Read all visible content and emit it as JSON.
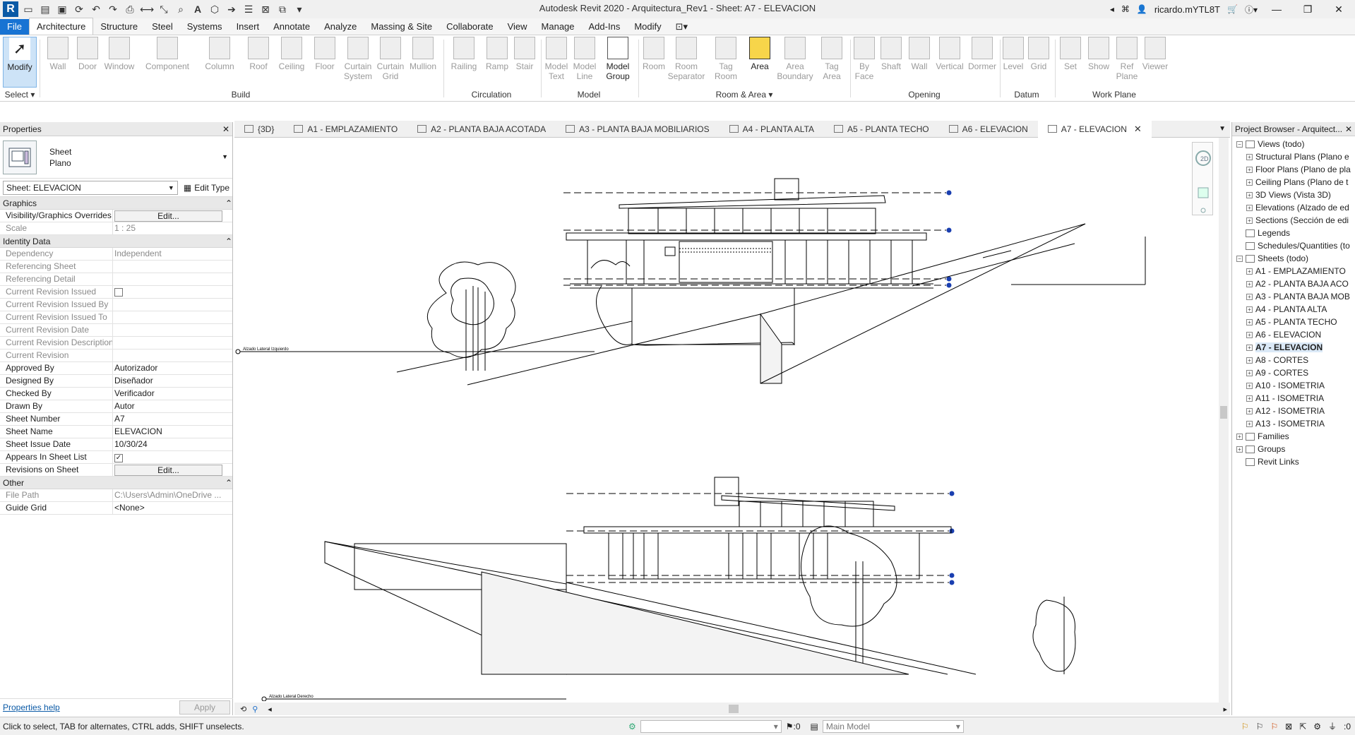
{
  "window": {
    "title": "Autodesk Revit 2020 - Arquitectura_Rev1 - Sheet: A7 - ELEVACION",
    "user": "ricardo.mYTL8T"
  },
  "ribbon_tabs": [
    "File",
    "Architecture",
    "Structure",
    "Steel",
    "Systems",
    "Insert",
    "Annotate",
    "Analyze",
    "Massing & Site",
    "Collaborate",
    "View",
    "Manage",
    "Add-Ins",
    "Modify"
  ],
  "ribbon": {
    "select": {
      "modify": "Modify",
      "select": "Select"
    },
    "build": {
      "label": "Build",
      "wall": "Wall",
      "door": "Door",
      "window": "Window",
      "component": "Component",
      "column": "Column",
      "roof": "Roof",
      "ceiling": "Ceiling",
      "floor": "Floor",
      "curtain_system": "Curtain System",
      "curtain_grid": "Curtain Grid",
      "mullion": "Mullion"
    },
    "circulation": {
      "label": "Circulation",
      "railing": "Railing",
      "ramp": "Ramp",
      "stair": "Stair"
    },
    "model": {
      "label": "Model",
      "model_text": "Model Text",
      "model_line": "Model Line",
      "model_group": "Model Group"
    },
    "room_area": {
      "label": "Room & Area",
      "room": "Room",
      "room_separator": "Room Separator",
      "tag_room": "Tag Room",
      "area": "Area",
      "area_boundary": "Area Boundary",
      "tag_area": "Tag Area"
    },
    "opening": {
      "label": "Opening",
      "by_face": "By Face",
      "shaft": "Shaft",
      "wall": "Wall",
      "vertical": "Vertical",
      "dormer": "Dormer"
    },
    "datum": {
      "label": "Datum",
      "level": "Level",
      "grid": "Grid"
    },
    "work_plane": {
      "label": "Work Plane",
      "set": "Set",
      "show": "Show",
      "ref_plane": "Ref Plane",
      "viewer": "Viewer"
    }
  },
  "properties": {
    "header": "Properties",
    "type_name_line1": "Sheet",
    "type_name_line2": "Plano",
    "instance_selector": "Sheet: ELEVACION",
    "edit_type": "Edit Type",
    "groups": {
      "graphics": "Graphics",
      "identity": "Identity Data",
      "other": "Other"
    },
    "graphics": [
      {
        "k": "Visibility/Graphics Overrides",
        "v": "Edit...",
        "kind": "button"
      },
      {
        "k": "Scale",
        "v": "1 : 25",
        "kind": "disabled"
      }
    ],
    "identity": [
      {
        "k": "Dependency",
        "v": "Independent",
        "kind": "disabled"
      },
      {
        "k": "Referencing Sheet",
        "v": "",
        "kind": "disabled"
      },
      {
        "k": "Referencing Detail",
        "v": "",
        "kind": "disabled"
      },
      {
        "k": "Current Revision Issued",
        "v": "",
        "kind": "check-disabled"
      },
      {
        "k": "Current Revision Issued By",
        "v": "",
        "kind": "disabled"
      },
      {
        "k": "Current Revision Issued To",
        "v": "",
        "kind": "disabled"
      },
      {
        "k": "Current Revision Date",
        "v": "",
        "kind": "disabled"
      },
      {
        "k": "Current Revision Description",
        "v": "",
        "kind": "disabled"
      },
      {
        "k": "Current Revision",
        "v": "",
        "kind": "disabled"
      },
      {
        "k": "Approved By",
        "v": "Autorizador",
        "kind": "text"
      },
      {
        "k": "Designed By",
        "v": "Diseñador",
        "kind": "text"
      },
      {
        "k": "Checked By",
        "v": "Verificador",
        "kind": "text"
      },
      {
        "k": "Drawn By",
        "v": "Autor",
        "kind": "text"
      },
      {
        "k": "Sheet Number",
        "v": "A7",
        "kind": "text"
      },
      {
        "k": "Sheet Name",
        "v": "ELEVACION",
        "kind": "text"
      },
      {
        "k": "Sheet Issue Date",
        "v": "10/30/24",
        "kind": "text"
      },
      {
        "k": "Appears In Sheet List",
        "v": "✓",
        "kind": "check"
      },
      {
        "k": "Revisions on Sheet",
        "v": "Edit...",
        "kind": "button"
      }
    ],
    "other": [
      {
        "k": "File Path",
        "v": "C:\\Users\\Admin\\OneDrive ...",
        "kind": "disabled"
      },
      {
        "k": "Guide Grid",
        "v": "<None>",
        "kind": "text"
      }
    ],
    "help_link": "Properties help",
    "apply": "Apply"
  },
  "view_tabs": [
    {
      "label": "{3D}",
      "active": false
    },
    {
      "label": "A1 - EMPLAZAMIENTO",
      "active": false
    },
    {
      "label": "A2 - PLANTA BAJA ACOTADA",
      "active": false
    },
    {
      "label": "A3 - PLANTA BAJA MOBILIARIOS",
      "active": false
    },
    {
      "label": "A4 - PLANTA ALTA",
      "active": false
    },
    {
      "label": "A5 - PLANTA TECHO",
      "active": false
    },
    {
      "label": "A6 - ELEVACION",
      "active": false
    },
    {
      "label": "A7 - ELEVACION",
      "active": true
    }
  ],
  "canvas": {
    "view1_title": "Alzado Lateral Izquierdo",
    "view2_title": "Alzado Lateral Derecho"
  },
  "browser": {
    "header": "Project Browser - Arquitect...",
    "items": [
      {
        "label": "Views (todo)",
        "level": 0,
        "toggle": "−",
        "icon": true
      },
      {
        "label": "Structural Plans (Plano e",
        "level": 1,
        "toggle": "+",
        "icon": false
      },
      {
        "label": "Floor Plans (Plano de pla",
        "level": 1,
        "toggle": "+",
        "icon": false
      },
      {
        "label": "Ceiling Plans (Plano de t",
        "level": 1,
        "toggle": "+",
        "icon": false
      },
      {
        "label": "3D Views (Vista 3D)",
        "level": 1,
        "toggle": "+",
        "icon": false
      },
      {
        "label": "Elevations (Alzado de ed",
        "level": 1,
        "toggle": "+",
        "icon": false
      },
      {
        "label": "Sections (Sección de edi",
        "level": 1,
        "toggle": "+",
        "icon": false
      },
      {
        "label": "Legends",
        "level": 0,
        "toggle": "",
        "icon": true
      },
      {
        "label": "Schedules/Quantities (to",
        "level": 0,
        "toggle": "",
        "icon": true
      },
      {
        "label": "Sheets (todo)",
        "level": 0,
        "toggle": "−",
        "icon": true
      },
      {
        "label": "A1 - EMPLAZAMIENTO",
        "level": 1,
        "toggle": "+",
        "icon": false
      },
      {
        "label": "A2 - PLANTA BAJA ACO",
        "level": 1,
        "toggle": "+",
        "icon": false
      },
      {
        "label": "A3 - PLANTA BAJA MOB",
        "level": 1,
        "toggle": "+",
        "icon": false
      },
      {
        "label": "A4 - PLANTA ALTA",
        "level": 1,
        "toggle": "+",
        "icon": false
      },
      {
        "label": "A5 - PLANTA TECHO",
        "level": 1,
        "toggle": "+",
        "icon": false
      },
      {
        "label": "A6 - ELEVACION",
        "level": 1,
        "toggle": "+",
        "icon": false
      },
      {
        "label": "A7 - ELEVACION",
        "level": 1,
        "toggle": "+",
        "icon": false,
        "selected": true
      },
      {
        "label": "A8 - CORTES",
        "level": 1,
        "toggle": "+",
        "icon": false
      },
      {
        "label": "A9 - CORTES",
        "level": 1,
        "toggle": "+",
        "icon": false
      },
      {
        "label": "A10 - ISOMETRIA",
        "level": 1,
        "toggle": "+",
        "icon": false
      },
      {
        "label": "A11 - ISOMETRIA",
        "level": 1,
        "toggle": "+",
        "icon": false
      },
      {
        "label": "A12 - ISOMETRIA",
        "level": 1,
        "toggle": "+",
        "icon": false
      },
      {
        "label": "A13 - ISOMETRIA",
        "level": 1,
        "toggle": "+",
        "icon": false
      },
      {
        "label": "Families",
        "level": 0,
        "toggle": "+",
        "icon": true
      },
      {
        "label": "Groups",
        "level": 0,
        "toggle": "+",
        "icon": true
      },
      {
        "label": "Revit Links",
        "level": 0,
        "toggle": "",
        "icon": true
      }
    ]
  },
  "status": {
    "hint": "Click to select, TAB for alternates, CTRL adds, SHIFT unselects.",
    "zero1": ":0",
    "model": "Main Model",
    "zero2": ":0"
  }
}
